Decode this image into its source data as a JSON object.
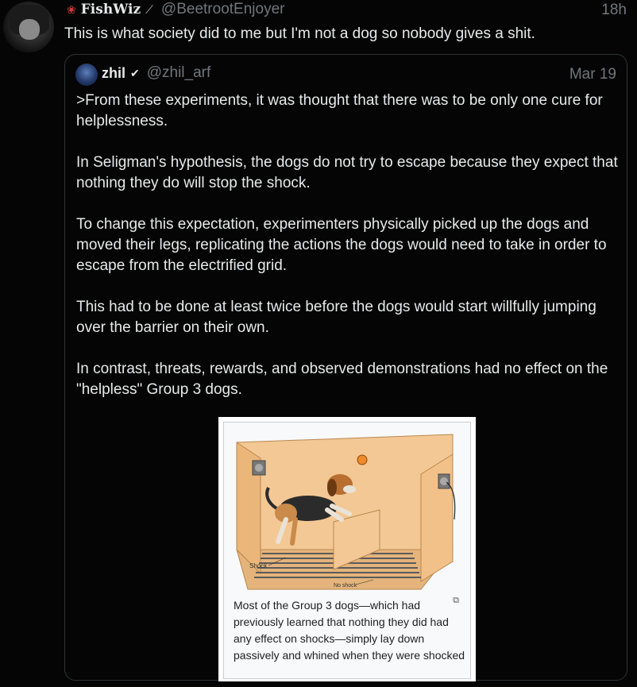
{
  "tweet": {
    "display_name": "FishWiz",
    "handle": "@BeetrootEnjoyer",
    "time": "18h",
    "text": "This is what society did to me but I'm not a dog so nobody gives a shit."
  },
  "quote": {
    "display_name": "zhil",
    "handle": "@zhil_arf",
    "date": "Mar 19",
    "paragraphs": [
      ">From these experiments, it was thought that there was to be only one cure for helplessness.",
      "In Seligman's hypothesis, the dogs do not try to escape because they expect that nothing they do will stop the shock.",
      "To change this expectation, experimenters physically picked up the dogs and moved their legs, replicating the actions the dogs would need to take in order to escape from the electrified grid.",
      "This had to be done at least twice before the dogs would start willfully jumping over the barrier on their own.",
      "In contrast, threats, rewards, and observed demonstrations had no effect on the \"helpless\" Group 3 dogs."
    ],
    "figure": {
      "label_shock": "Shock",
      "label_no_shock": "No shock",
      "caption": "Most of the Group 3 dogs—which had previously learned that nothing they did had any effect on shocks—simply lay down passively and whined when they were shocked"
    }
  },
  "icons": {
    "verified": "checkmark-icon",
    "enlarge": "enlarge-icon",
    "rose": "rose-icon",
    "wand": "wand-icon"
  }
}
